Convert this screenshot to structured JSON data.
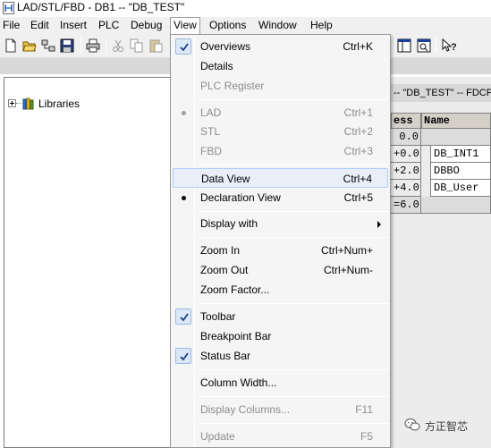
{
  "window": {
    "title": "LAD/STL/FBD  - DB1 -- \"DB_TEST\""
  },
  "menubar": {
    "items": [
      "File",
      "Edit",
      "Insert",
      "PLC",
      "Debug",
      "View",
      "Options",
      "Window",
      "Help"
    ],
    "active": "View"
  },
  "toolbar": {
    "icons": [
      "new-icon",
      "open-icon",
      "network-icon",
      "save-icon",
      "print-icon",
      "cut-icon",
      "copy-icon",
      "paste-icon",
      "window-icon",
      "zoom-window-icon",
      "help-icon"
    ]
  },
  "tree": {
    "items": [
      {
        "label": "Libraries",
        "icon": "libraries-icon",
        "expanded": false
      }
    ]
  },
  "editor": {
    "title": "-- \"DB_TEST\" -- FDCP",
    "columns": [
      "ess",
      "Name"
    ],
    "rows": [
      {
        "address": "0.0",
        "name": ""
      },
      {
        "address": "+0.0",
        "name": "DB_INT1"
      },
      {
        "address": "+2.0",
        "name": "DBBO"
      },
      {
        "address": "+4.0",
        "name": "DB_User"
      },
      {
        "address": "=6.0",
        "name": ""
      }
    ]
  },
  "view_menu": {
    "items": [
      {
        "label": "Overviews",
        "shortcut": "Ctrl+K",
        "checked": true,
        "enabled": true
      },
      {
        "label": "Details",
        "shortcut": "",
        "enabled": true
      },
      {
        "label": "PLC Register",
        "shortcut": "",
        "enabled": false
      },
      {
        "label": "LAD",
        "shortcut": "Ctrl+1",
        "enabled": false,
        "bullet": true
      },
      {
        "label": "STL",
        "shortcut": "Ctrl+2",
        "enabled": false
      },
      {
        "label": "FBD",
        "shortcut": "Ctrl+3",
        "enabled": false
      },
      {
        "label": "Data View",
        "shortcut": "Ctrl+4",
        "enabled": true,
        "highlighted": true
      },
      {
        "label": "Declaration View",
        "shortcut": "Ctrl+5",
        "enabled": true,
        "bullet": true
      },
      {
        "label": "Display with",
        "shortcut": "",
        "enabled": true,
        "submenu": true
      },
      {
        "label": "Zoom In",
        "shortcut": "Ctrl+Num+",
        "enabled": true
      },
      {
        "label": "Zoom Out",
        "shortcut": "Ctrl+Num-",
        "enabled": true
      },
      {
        "label": "Zoom Factor...",
        "shortcut": "",
        "enabled": true
      },
      {
        "label": "Toolbar",
        "shortcut": "",
        "enabled": true,
        "checked": true
      },
      {
        "label": "Breakpoint Bar",
        "shortcut": "",
        "enabled": true
      },
      {
        "label": "Status Bar",
        "shortcut": "",
        "enabled": true,
        "checked": true
      },
      {
        "label": "Column Width...",
        "shortcut": "",
        "enabled": true
      },
      {
        "label": "Display Columns...",
        "shortcut": "F11",
        "enabled": false
      },
      {
        "label": "Update",
        "shortcut": "F5",
        "enabled": false
      }
    ]
  },
  "watermark": {
    "text": "方正智芯"
  },
  "colors": {
    "highlight": "#e8eff8",
    "check_bg": "#dbe8f7",
    "disabled_text": "#8d8d8d"
  }
}
